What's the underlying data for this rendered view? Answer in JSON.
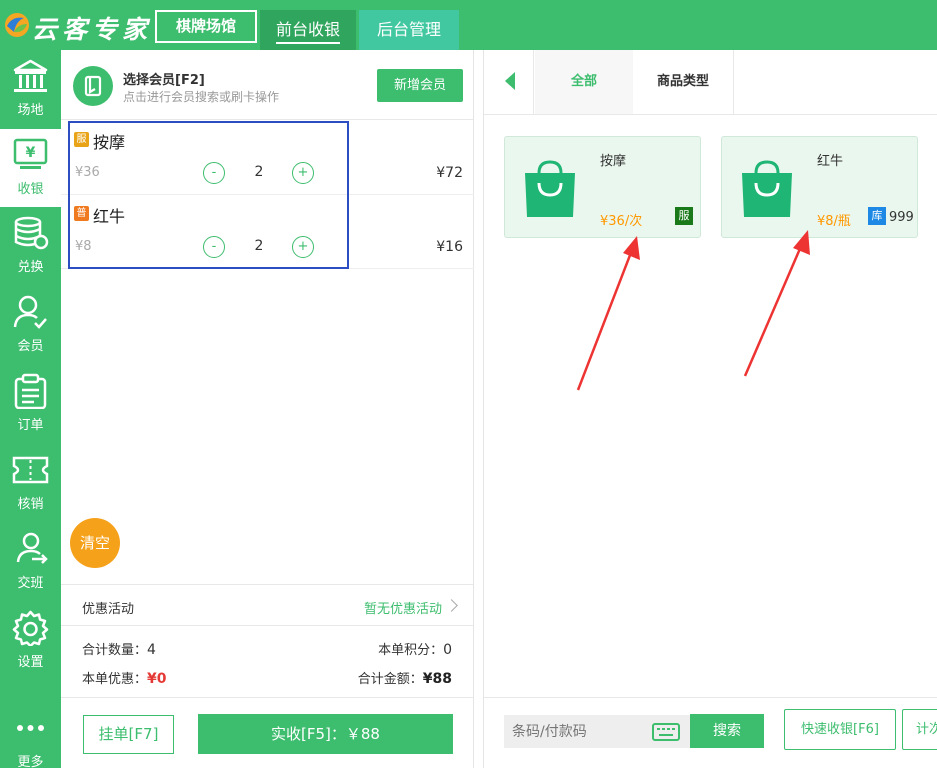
{
  "header": {
    "app_title": "云客专家",
    "venue_button": "棋牌场馆",
    "tabs": [
      {
        "label": "前台收银",
        "active": true
      },
      {
        "label": "后台管理",
        "active": false
      }
    ]
  },
  "sidebar": {
    "items": [
      {
        "label": "场地",
        "icon": "building-icon"
      },
      {
        "label": "收银",
        "icon": "cashier-icon",
        "active": true
      },
      {
        "label": "兑换",
        "icon": "coins-icon"
      },
      {
        "label": "会员",
        "icon": "member-icon"
      },
      {
        "label": "订单",
        "icon": "clipboard-icon"
      },
      {
        "label": "核销",
        "icon": "ticket-icon"
      },
      {
        "label": "交班",
        "icon": "shift-icon"
      },
      {
        "label": "设置",
        "icon": "gear-icon"
      },
      {
        "label": "更多",
        "icon": "more-icon"
      }
    ]
  },
  "member": {
    "title": "选择会员[F2]",
    "hint": "点击进行会员搜索或刷卡操作",
    "add_label": "新增会员"
  },
  "order": {
    "items": [
      {
        "badge": "服",
        "badge_color": "#e8a317",
        "name": "按摩",
        "unit_price": "¥36",
        "minus": "-",
        "qty": "2",
        "plus": "+",
        "subtotal": "¥72"
      },
      {
        "badge": "普",
        "badge_color": "#f07a1f",
        "name": "红牛",
        "unit_price": "¥8",
        "minus": "-",
        "qty": "2",
        "plus": "+",
        "subtotal": "¥16"
      }
    ],
    "clear_label": "清空",
    "promo_label": "优惠活动",
    "promo_value": "暂无优惠活动",
    "total_qty_label": "合计数量：",
    "total_qty": "4",
    "points_label": "本单积分：",
    "points": "0",
    "discount_label": "本单优惠：",
    "discount": "¥0",
    "total_amount_label": "合计金额：",
    "total_amount": "¥88",
    "hold_label": "挂单[F7]",
    "pay_label": "实收[F5]：￥88"
  },
  "catalog": {
    "tabs": [
      {
        "label": "全部",
        "active": true
      },
      {
        "label": "商品类型",
        "active": false
      }
    ],
    "products": [
      {
        "name": "按摩",
        "price": "¥36/次",
        "tag": "服",
        "tag_color": "#1a7a1a",
        "stock": ""
      },
      {
        "name": "红牛",
        "price": "¥8/瓶",
        "tag": "库",
        "tag_color": "#1e88e5",
        "stock": "999"
      }
    ],
    "search_placeholder": "条码/付款码",
    "search_label": "搜索",
    "quick_label": "快速收银[F6]",
    "timer_label": "计次"
  },
  "colors": {
    "brand": "#3dbd6e",
    "orange": "#f6a11a",
    "price": "#ff9800",
    "annotation_arrow": "#ee3333",
    "selection_box": "#2c4ec2"
  }
}
